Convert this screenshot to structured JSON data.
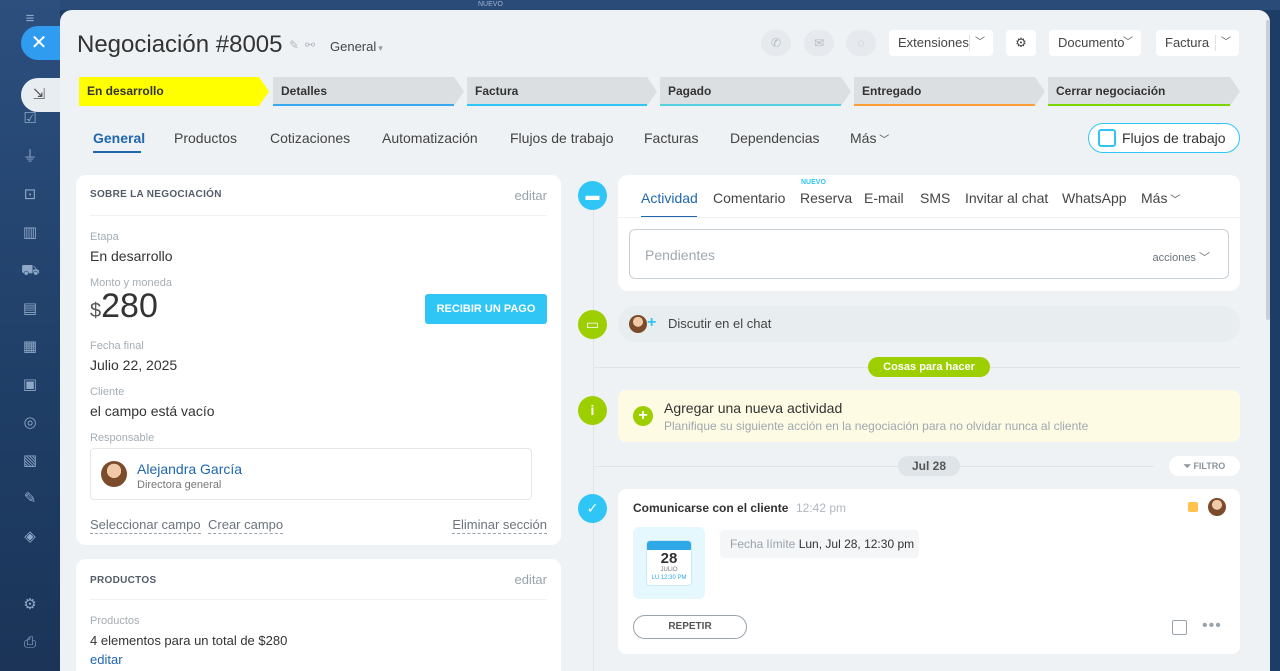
{
  "top_strip": {
    "badge": "NUEVO"
  },
  "header": {
    "title": "Negociación #8005",
    "category": "General",
    "extensions_label": "Extensiones",
    "document_label": "Documento",
    "invoice_label": "Factura"
  },
  "stages": [
    {
      "label": "En desarrollo",
      "color": "#ffff00",
      "line": "#ffff00"
    },
    {
      "label": "Detalles",
      "color": "#dbdfe2",
      "line": "#39a8ef"
    },
    {
      "label": "Factura",
      "color": "#dbdfe2",
      "line": "#2fc6f6"
    },
    {
      "label": "Pagado",
      "color": "#dbdfe2",
      "line": "#55d0e0"
    },
    {
      "label": "Entregado",
      "color": "#dbdfe2",
      "line": "#ff9d36"
    },
    {
      "label": "Cerrar negociación",
      "color": "#dbdfe2",
      "line": "#7bd500"
    }
  ],
  "tabs": [
    "General",
    "Productos",
    "Cotizaciones",
    "Automatización",
    "Flujos de trabajo",
    "Facturas",
    "Dependencias",
    "Más"
  ],
  "flow_button": "Flujos de trabajo",
  "about_card": {
    "heading": "SOBRE LA NEGOCIACIÓN",
    "edit": "editar",
    "stage_label": "Etapa",
    "stage_value": "En desarrollo",
    "amount_label": "Monto y moneda",
    "currency": "$",
    "amount": "280",
    "pay_button": "RECIBIR UN PAGO",
    "close_date_label": "Fecha final",
    "close_date": "Julio 22, 2025",
    "client_label": "Cliente",
    "client_value": "el campo está vacío",
    "responsible_label": "Responsable",
    "responsible_name": "Alejandra García",
    "responsible_role": "Directora general",
    "select_field": "Seleccionar campo",
    "create_field": "Crear campo",
    "delete_section": "Eliminar sección"
  },
  "products_card": {
    "heading": "PRODUCTOS",
    "edit": "editar",
    "label": "Productos",
    "summary": "4 elementos para un total de $280",
    "edit_link": "editar"
  },
  "editor": {
    "tabs": [
      "Actividad",
      "Comentario",
      "Reserva",
      "E-mail",
      "SMS",
      "Invitar al chat",
      "WhatsApp",
      "Más"
    ],
    "new_badge": "NUEVO",
    "placeholder": "Pendientes",
    "actions": "acciones"
  },
  "timeline": {
    "chat_text": "Discutir en el chat",
    "todo_pill": "Cosas para hacer",
    "add_title": "Agregar una nueva actividad",
    "add_sub": "Planifique su siguiente acción en la negociación para no olvidar nunca al cliente",
    "date_pill": "Jul 28",
    "filter": "FILTRO",
    "activity": {
      "title": "Comunicarse con el cliente",
      "time": "12:42 pm",
      "cal_day": "28",
      "cal_month": "JULIO",
      "cal_time": "LU 12:30 PM",
      "deadline_label": "Fecha límite",
      "deadline_value": "Lun, Jul 28, 12:30 pm",
      "repeat": "REPETIR"
    }
  }
}
